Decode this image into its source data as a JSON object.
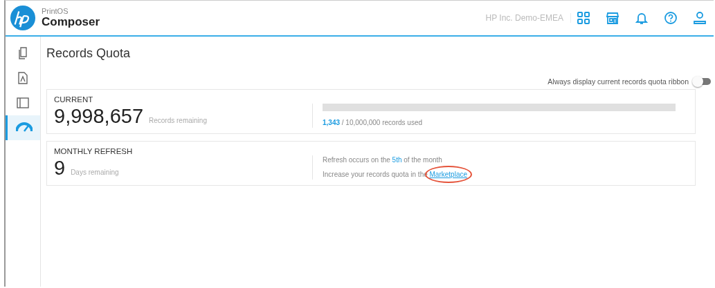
{
  "header": {
    "product": "PrintOS",
    "app": "Composer",
    "organization": "HP Inc. Demo-EMEA"
  },
  "sidebar": {
    "items": [
      {
        "kind": "documents",
        "selected": false
      },
      {
        "kind": "pdf",
        "selected": false
      },
      {
        "kind": "layout",
        "selected": false
      },
      {
        "kind": "gauge",
        "selected": true
      }
    ]
  },
  "page": {
    "title": "Records Quota"
  },
  "ribbon_toggle": {
    "label": "Always display current records quota ribbon",
    "on": false
  },
  "current": {
    "heading": "CURRENT",
    "value": "9,998,657",
    "caption": "Records remaining",
    "level": 0.0001,
    "used": "1,343",
    "used_rest": "/ 10,000,000 records used"
  },
  "monthly_refresh": {
    "heading": "MONTHLY REFRESH",
    "value": "9",
    "caption": "Days remaining",
    "refresh_before": "Refresh occurs on the",
    "refresh_day": "5th",
    "refresh_after": "of the month",
    "increase_text": "Increase your records quota in the",
    "link": "Marketplace"
  }
}
